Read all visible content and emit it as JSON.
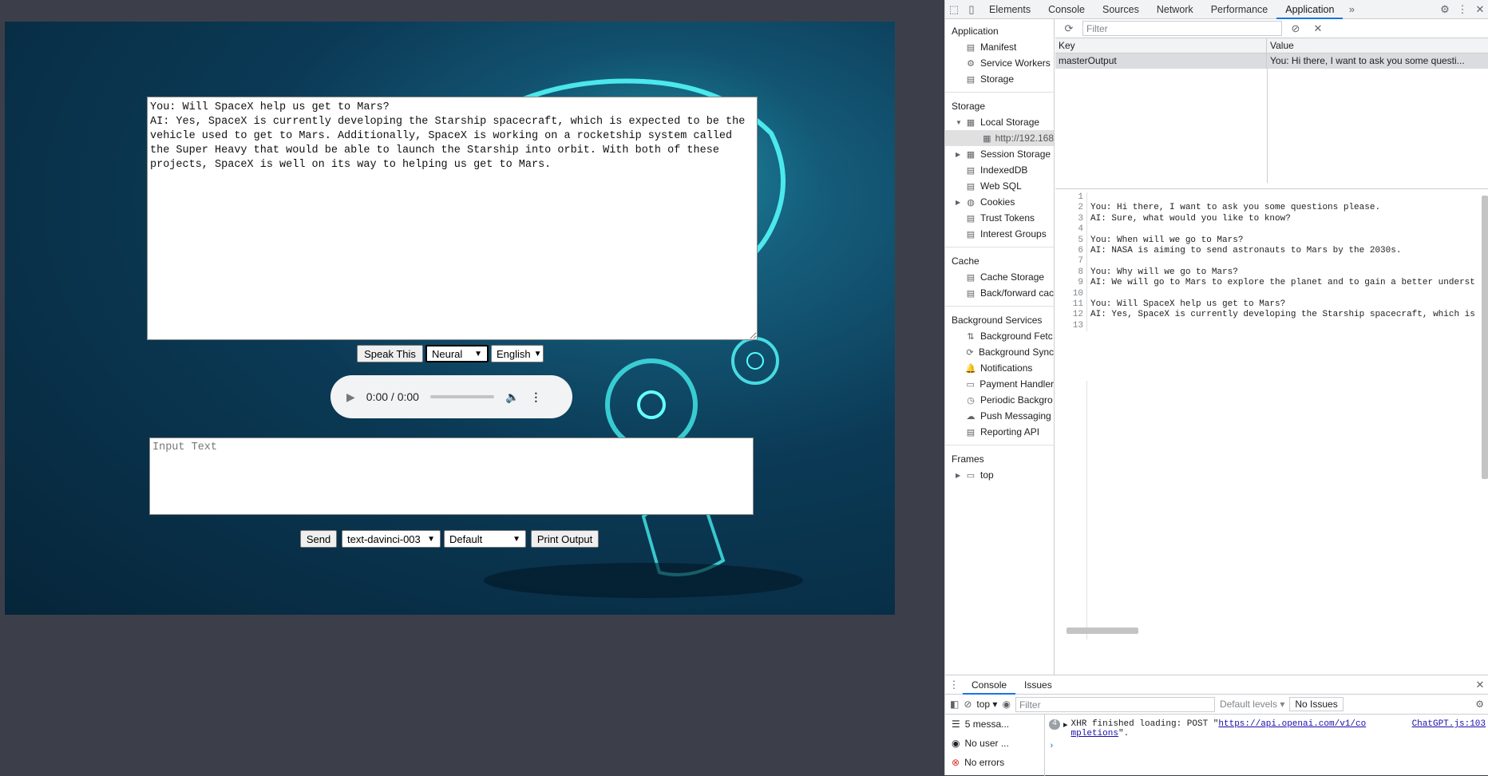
{
  "app": {
    "output_text": "You: Will SpaceX help us get to Mars?\nAI: Yes, SpaceX is currently developing the Starship spacecraft, which is expected to be the vehicle used to get to Mars. Additionally, SpaceX is working on a rocketship system called the Super Heavy that would be able to launch the Starship into orbit. With both of these projects, SpaceX is well on its way to helping us get to Mars.",
    "speak_label": "Speak This",
    "voice_value": "Neural",
    "lang_value": "English",
    "audio_time": "0:00 / 0:00",
    "input_placeholder": "Input Text",
    "send_label": "Send",
    "model_value": "text-davinci-003",
    "mode_value": "Default",
    "print_label": "Print Output"
  },
  "devtools": {
    "tabs": [
      "Elements",
      "Console",
      "Sources",
      "Network",
      "Performance",
      "Application"
    ],
    "active_tab": "Application",
    "more": "»",
    "sidebar": {
      "application_header": "Application",
      "application_items": [
        "Manifest",
        "Service Workers",
        "Storage"
      ],
      "storage_header": "Storage",
      "local_storage": "Local Storage",
      "origin": "http://192.168",
      "storage_items": [
        "Session Storage",
        "IndexedDB",
        "Web SQL",
        "Cookies",
        "Trust Tokens",
        "Interest Groups"
      ],
      "cache_header": "Cache",
      "cache_items": [
        "Cache Storage",
        "Back/forward cac"
      ],
      "bg_header": "Background Services",
      "bg_items": [
        "Background Fetc",
        "Background Sync",
        "Notifications",
        "Payment Handler",
        "Periodic Backgro",
        "Push Messaging",
        "Reporting API"
      ],
      "frames_header": "Frames",
      "frames_item": "top"
    },
    "filter_placeholder": "Filter",
    "table": {
      "key_header": "Key",
      "value_header": "Value",
      "row_key": "masterOutput",
      "row_value": "You: Hi there, I want to ask you some questi..."
    },
    "preview_lines": [
      "",
      "You: Hi there, I want to ask you some questions please.",
      "AI: Sure, what would you like to know?",
      "",
      "You: When will we go to Mars?",
      "AI: NASA is aiming to send astronauts to Mars by the 2030s.",
      "",
      "You: Why will we go to Mars?",
      "AI: We will go to Mars to explore the planet and to gain a better underst",
      "",
      "You: Will SpaceX help us get to Mars?",
      "AI: Yes, SpaceX is currently developing the Starship spacecraft, which is",
      ""
    ],
    "console": {
      "tabs": [
        "Console",
        "Issues"
      ],
      "context": "top",
      "filter_placeholder": "Filter",
      "levels": "Default levels",
      "issues": "No Issues",
      "side_items": [
        "5 messa...",
        "No user ...",
        "No errors"
      ],
      "msg_count": "4",
      "msg_prefix": "XHR finished loading: POST \"",
      "msg_url": "https://api.openai.com/v1/co",
      "msg_url2": "mpletions",
      "msg_suffix": "\".",
      "msg_source": "ChatGPT.js:103"
    }
  }
}
